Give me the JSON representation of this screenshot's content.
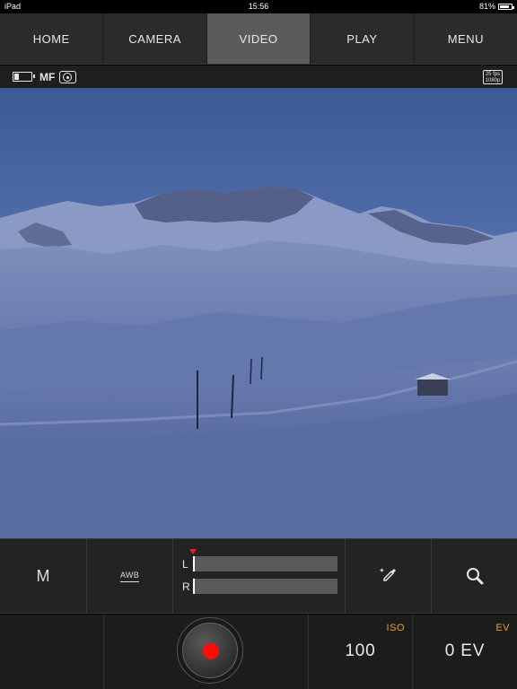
{
  "status_bar": {
    "device": "iPad",
    "time": "15:56",
    "battery_percent": "81%"
  },
  "nav": {
    "tabs": [
      "HOME",
      "CAMERA",
      "VIDEO",
      "PLAY",
      "MENU"
    ],
    "active": "VIDEO"
  },
  "info_bar": {
    "focus_mode": "MF",
    "battery_icon": "battery-low-icon",
    "metering_icon": "spot-metering-icon",
    "video_format_line1": "25 fps",
    "video_format_line2": "1080p"
  },
  "viewfinder": {
    "content": "snowy-mountain-landscape-dusk"
  },
  "controls": {
    "exposure_mode": "M",
    "white_balance": "AWB",
    "audio": {
      "left_label": "L",
      "right_label": "R",
      "left_level": 0.0,
      "right_level": 0.0
    },
    "picker_icon": "eyedropper-icon",
    "zoom_icon": "magnifier-icon"
  },
  "bottom": {
    "iso_label": "ISO",
    "iso_value": "100",
    "ev_label": "EV",
    "ev_value": "0 EV"
  },
  "colors": {
    "accent": "#f0a01e",
    "record": "#ff0a0a",
    "active_tab": "#5b5b5b"
  }
}
